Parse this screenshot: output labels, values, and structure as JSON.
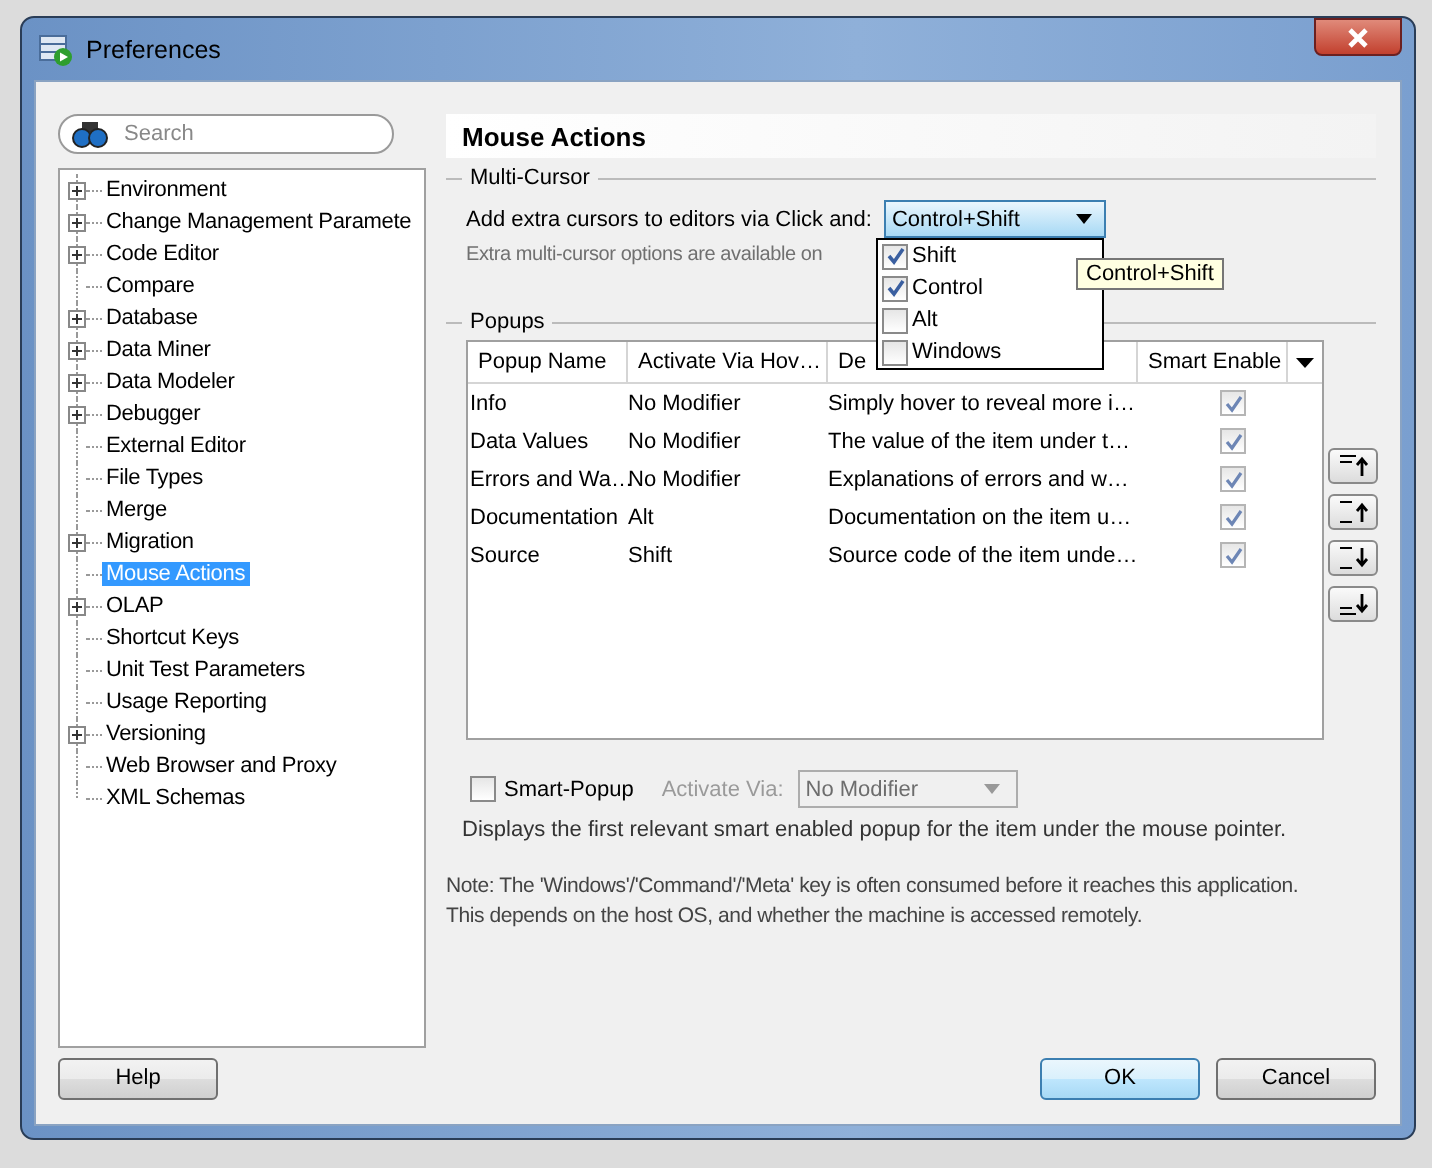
{
  "window": {
    "title": "Preferences"
  },
  "search": {
    "placeholder": "Search"
  },
  "tree": [
    {
      "label": "Environment",
      "expandable": true,
      "selected": false
    },
    {
      "label": "Change Management Paramete",
      "expandable": true,
      "selected": false
    },
    {
      "label": "Code Editor",
      "expandable": true,
      "selected": false
    },
    {
      "label": "Compare",
      "expandable": false,
      "selected": false
    },
    {
      "label": "Database",
      "expandable": true,
      "selected": false
    },
    {
      "label": "Data Miner",
      "expandable": true,
      "selected": false
    },
    {
      "label": "Data Modeler",
      "expandable": true,
      "selected": false
    },
    {
      "label": "Debugger",
      "expandable": true,
      "selected": false
    },
    {
      "label": "External Editor",
      "expandable": false,
      "selected": false
    },
    {
      "label": "File Types",
      "expandable": false,
      "selected": false
    },
    {
      "label": "Merge",
      "expandable": false,
      "selected": false
    },
    {
      "label": "Migration",
      "expandable": true,
      "selected": false
    },
    {
      "label": "Mouse Actions",
      "expandable": false,
      "selected": true
    },
    {
      "label": "OLAP",
      "expandable": true,
      "selected": false
    },
    {
      "label": "Shortcut Keys",
      "expandable": false,
      "selected": false
    },
    {
      "label": "Unit Test Parameters",
      "expandable": false,
      "selected": false
    },
    {
      "label": "Usage Reporting",
      "expandable": false,
      "selected": false
    },
    {
      "label": "Versioning",
      "expandable": true,
      "selected": false
    },
    {
      "label": "Web Browser and Proxy",
      "expandable": false,
      "selected": false
    },
    {
      "label": "XML Schemas",
      "expandable": false,
      "selected": false
    }
  ],
  "page_title": "Mouse Actions",
  "multi_cursor": {
    "legend": "Multi-Cursor",
    "label": "Add extra cursors to editors via Click and:",
    "combo_value": "Control+Shift",
    "hint": "Extra multi-cursor options are available on",
    "menu": [
      {
        "label": "Shift",
        "checked": true
      },
      {
        "label": "Control",
        "checked": true
      },
      {
        "label": "Alt",
        "checked": false
      },
      {
        "label": "Windows",
        "checked": false
      }
    ],
    "tooltip": "Control+Shift"
  },
  "popups": {
    "legend": "Popups",
    "columns": [
      "Popup Name",
      "Activate Via Hov…",
      "De",
      "Smart Enable"
    ],
    "rows": [
      {
        "name": "Info",
        "activate": "No Modifier",
        "description": "Simply hover to reveal more i…",
        "smart_enabled": true
      },
      {
        "name": "Data Values",
        "activate": "No Modifier",
        "description": "The value of the item under t…",
        "smart_enabled": true
      },
      {
        "name": "Errors and Wa…",
        "activate": "No Modifier",
        "description": "Explanations of errors and w…",
        "smart_enabled": true
      },
      {
        "name": "Documentation",
        "activate": "Alt",
        "description": "Documentation on the item u…",
        "smart_enabled": true
      },
      {
        "name": "Source",
        "activate": "Shift",
        "description": "Source code of the item unde…",
        "smart_enabled": true
      }
    ],
    "smart_popup": {
      "label": "Smart-Popup",
      "checked": false,
      "activate_label": "Activate Via:",
      "activate_value": "No Modifier",
      "disabled": true
    },
    "description": "Displays the first relevant smart enabled popup for the item under the mouse pointer."
  },
  "note": [
    "Note: The 'Windows'/'Command'/'Meta' key is often consumed before it reaches this application.",
    "This depends on the host OS, and whether the machine is accessed remotely."
  ],
  "buttons": {
    "help": "Help",
    "ok": "OK",
    "cancel": "Cancel"
  }
}
